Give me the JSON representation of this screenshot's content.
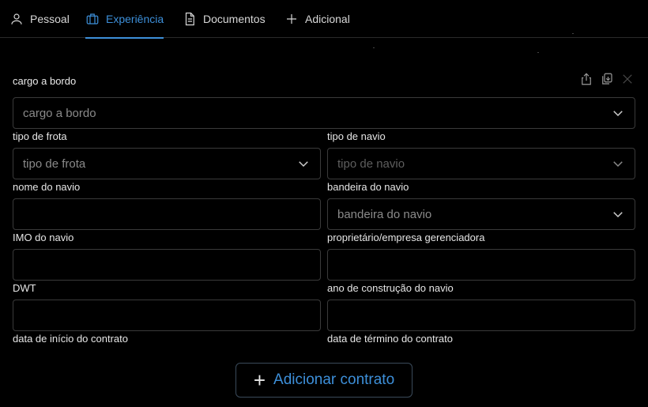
{
  "tabs": [
    {
      "label": "Pessoal",
      "icon": "user-icon",
      "active": false
    },
    {
      "label": "Experiência",
      "icon": "briefcase-icon",
      "active": true
    },
    {
      "label": "Documentos",
      "icon": "document-icon",
      "active": false
    },
    {
      "label": "Adicional",
      "icon": "plus-icon",
      "active": false
    }
  ],
  "section": {
    "title": "cargo a bordo",
    "cargo_placeholder": "cargo a bordo"
  },
  "fields": {
    "tipo_frota": {
      "label": "tipo de frota",
      "placeholder": "tipo de frota"
    },
    "tipo_navio": {
      "label": "tipo de navio",
      "placeholder": "tipo de navio"
    },
    "nome_navio": {
      "label": "nome do navio"
    },
    "bandeira_navio": {
      "label": "bandeira do navio",
      "placeholder": "bandeira do navio"
    },
    "imo_navio": {
      "label": "IMO do navio"
    },
    "proprietario": {
      "label": "proprietário/empresa gerenciadora"
    },
    "dwt": {
      "label": "DWT"
    },
    "ano_construcao": {
      "label": "ano de construção do navio"
    },
    "data_inicio": {
      "label": "data de início do contrato"
    },
    "data_termino": {
      "label": "data de término do contrato"
    }
  },
  "add_button": {
    "label": "Adicionar contrato"
  },
  "colors": {
    "accent": "#3d8fd9",
    "border": "#3a3a3a",
    "background": "#000000"
  }
}
